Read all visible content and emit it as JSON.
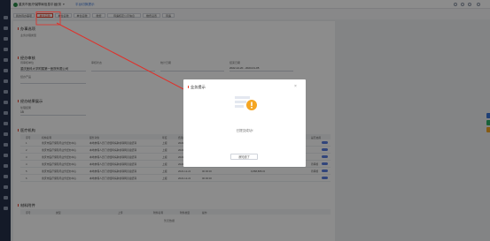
{
  "topbar": {
    "system_title": "重庆市医疗保障局信息平台",
    "menu_label": "业务",
    "link_label": "平台切换提示"
  },
  "tabs": [
    "我的待办事项",
    "单位征缴",
    "单位征缴",
    "单位征缴",
    "缴费",
    "待遇核定公示信息",
    "缴费设置",
    "待遇"
  ],
  "main": {
    "section_basic": "办事选项",
    "basic_field_label": "业务办理类型",
    "section_review": "经办审核",
    "review_fields": [
      {
        "label": "待审核单位",
        "value": "重庆医科大学附属第一医院有限公司"
      },
      {
        "label": "审核状态",
        "value": ""
      },
      {
        "label": "统计日期",
        "value": ""
      },
      {
        "label": "结束日期",
        "value": "2022-12-20  -  2023-01-05"
      }
    ],
    "review_sub_label": "经办产品",
    "section_other": "经办结果展示",
    "other_label": "处理结果",
    "other_value": "15",
    "section_list": "医疗机构",
    "list_headers": [
      "序号",
      "机构名称",
      "服务对象",
      "年度",
      "费用类别",
      "开始时间",
      "结束时间",
      "结算金额",
      "审核结果",
      "是否启用"
    ],
    "list_rows": [
      [
        "1",
        "重庆市医疗保障局业务经办中心",
        "本地参保人员门诊慢特病跨省联网直接结算",
        "上报",
        "2022-12-21",
        "00:00:00",
        "",
        "",
        "",
        ""
      ],
      [
        "2",
        "重庆市医疗保障局业务经办中心",
        "本地参保人员门诊慢特病跨省联网直接结算",
        "上报",
        "2022-12-21",
        "00:00:00",
        "",
        "",
        "",
        ""
      ],
      [
        "3",
        "重庆市医疗保障局业务经办中心",
        "本地参保人员门诊慢特病跨省联网直接结算",
        "上报",
        "2022-12-21",
        "00:00:00",
        "",
        "",
        "",
        ""
      ],
      [
        "4",
        "重庆市医疗保障局业务经办中心",
        "本地参保人员门诊慢特病跨省联网直接结算",
        "上报",
        "2022-12-21",
        "00:00:00",
        "",
        "4,77,880.00",
        "",
        "待审核"
      ],
      [
        "5",
        "重庆市医疗保障局业务经办中心",
        "本地参保人员门诊慢特病跨省联网直接结算",
        "上报",
        "2022-12-21",
        "00:00:00",
        "",
        "9,888,888.00",
        "",
        "待审核"
      ],
      [
        "6",
        "重庆市医疗保障局业务经办中心",
        "本地参保人员门诊慢特病跨省联网直接结算",
        "上报",
        "2022-12-21",
        "00:00:00",
        "",
        "",
        "",
        ""
      ]
    ],
    "section_attach": "材料附件",
    "attach_headers": [
      "序号",
      "类型",
      "上传",
      "附件名称",
      "附件类型",
      "操作"
    ],
    "attach_empty": "暂无数据"
  },
  "dialog": {
    "title": "业务提示",
    "message": "已提交成功!",
    "button": "我知道了"
  },
  "colors": {
    "accent": "#e9442f",
    "sidebar": "#26314a",
    "warning": "#f5a623",
    "toggle": "#5a7fe0"
  },
  "icons": [
    "logo-icon",
    "close-icon",
    "warning-icon",
    "user-icon",
    "settings-icon"
  ]
}
